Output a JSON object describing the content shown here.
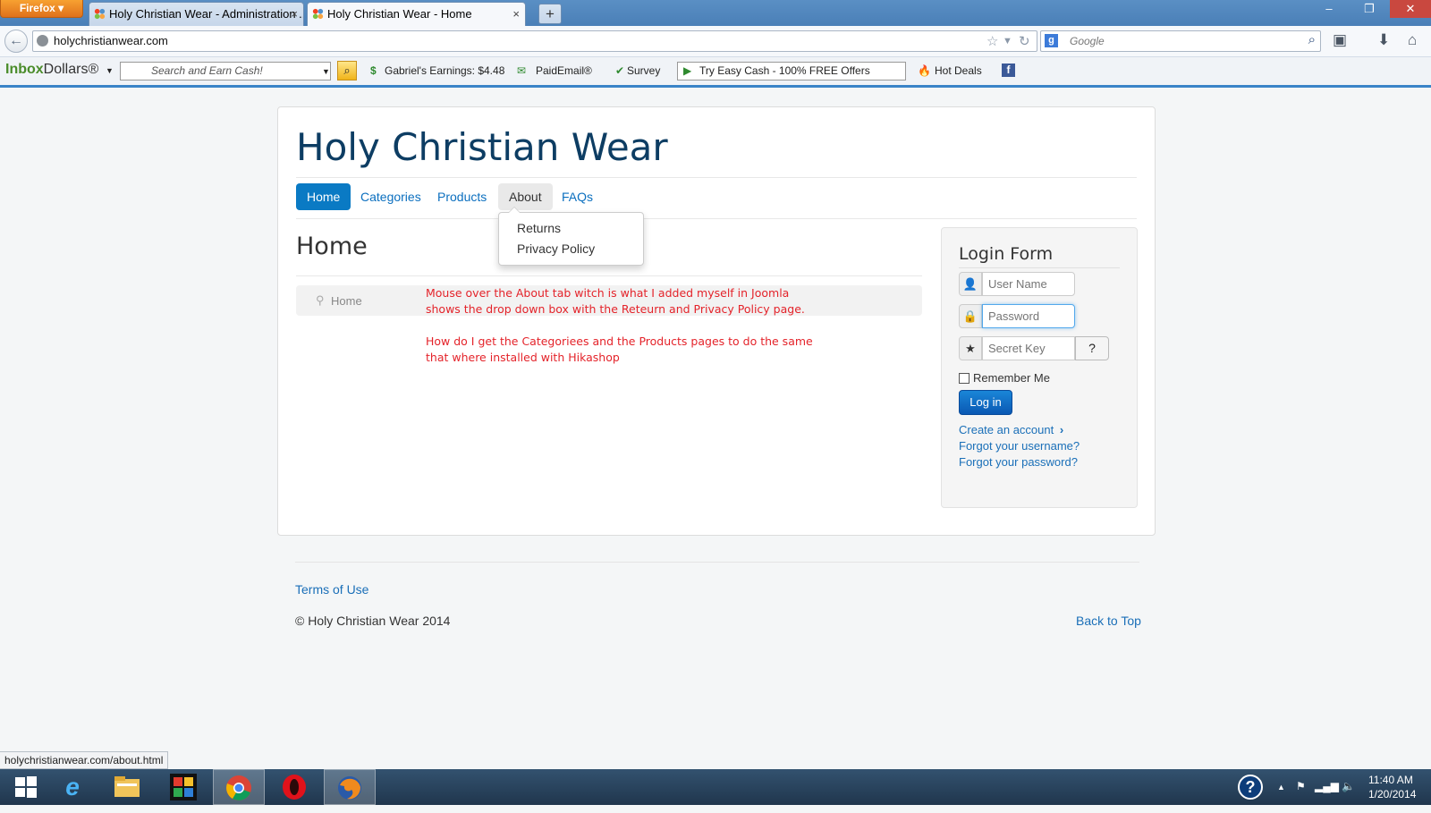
{
  "browser": {
    "menu_button": "Firefox ▾",
    "tabs": [
      {
        "title": "Holy Christian Wear - Administration ...",
        "close": "×"
      },
      {
        "title": "Holy Christian Wear - Home",
        "close": "×"
      }
    ],
    "new_tab": "+",
    "window_controls": {
      "minimize": "–",
      "restore": "❐",
      "close": "✕"
    },
    "url": "holychristianwear.com",
    "search_engine": "g",
    "search_placeholder": "Google",
    "status_url": "holychristianwear.com/about.html"
  },
  "inbox_toolbar": {
    "logo_prefix": "Inbox",
    "logo_suffix": "Dollars®",
    "search_placeholder": "Search and Earn Cash!",
    "earnings": "Gabriel's Earnings: $4.48",
    "paid_email": "PaidEmail®",
    "survey": "Survey",
    "offers": "Try Easy Cash - 100% FREE Offers",
    "hot_deals": "Hot Deals",
    "facebook": "f"
  },
  "site": {
    "title": "Holy Christian Wear",
    "nav": [
      {
        "label": "Home"
      },
      {
        "label": "Categories"
      },
      {
        "label": "Products"
      },
      {
        "label": "About"
      },
      {
        "label": "FAQs"
      }
    ],
    "dropdown": [
      "Returns",
      "Privacy Policy"
    ],
    "page_heading": "Home",
    "breadcrumb": "Home",
    "annotation": [
      "Mouse over the About tab witch is what I added myself in Joomla",
      "shows the drop down box with the Reteurn and Privacy Policy page.",
      "How do I get the Categoriees and the Products pages to do the same",
      "that where installed with Hikashop"
    ],
    "login": {
      "title": "Login Form",
      "username_placeholder": "User Name",
      "password_placeholder": "Password",
      "secret_placeholder": "Secret Key",
      "remember": "Remember Me",
      "button": "Log in",
      "create_account": "Create an account",
      "forgot_username": "Forgot your username?",
      "forgot_password": "Forgot your password?"
    },
    "footer": {
      "terms": "Terms of Use",
      "copyright": "© Holy Christian Wear 2014",
      "back_to_top": "Back to Top"
    }
  },
  "taskbar": {
    "time": "11:40 AM",
    "date": "1/20/2014"
  }
}
